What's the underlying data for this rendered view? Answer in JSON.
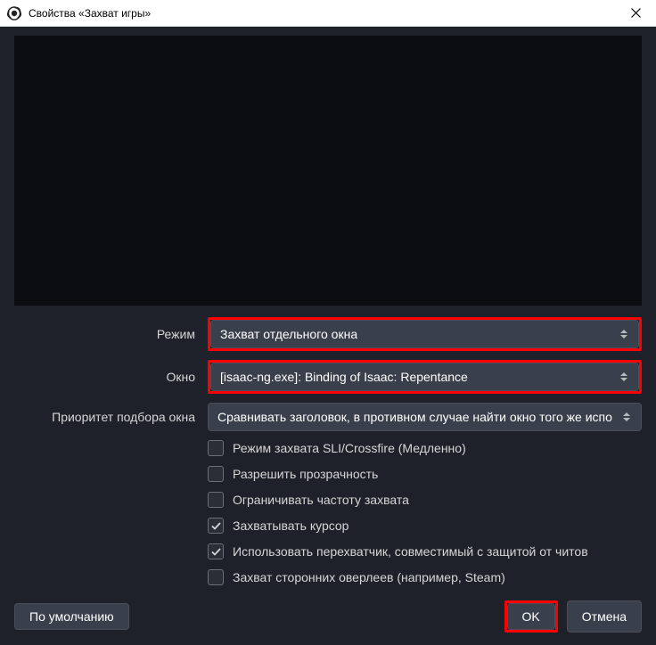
{
  "titlebar": {
    "title": "Свойства «Захват игры»"
  },
  "form": {
    "mode": {
      "label": "Режим",
      "value": "Захват отдельного окна"
    },
    "window": {
      "label": "Окно",
      "value": "[isaac-ng.exe]: Binding of Isaac: Repentance"
    },
    "priority": {
      "label": "Приоритет подбора окна",
      "value": "Сравнивать заголовок, в противном случае найти окно того же испо"
    }
  },
  "checkboxes": {
    "sli": "Режим захвата SLI/Crossfire (Медленно)",
    "transparency": "Разрешить прозрачность",
    "limit_fps": "Ограничивать частоту захвата",
    "cursor": "Захватывать курсор",
    "anticheat": "Использовать перехватчик, совместимый с защитой от читов",
    "overlays": "Захват сторонних оверлеев (например, Steam)"
  },
  "buttons": {
    "defaults": "По умолчанию",
    "ok": "OK",
    "cancel": "Отмена"
  }
}
